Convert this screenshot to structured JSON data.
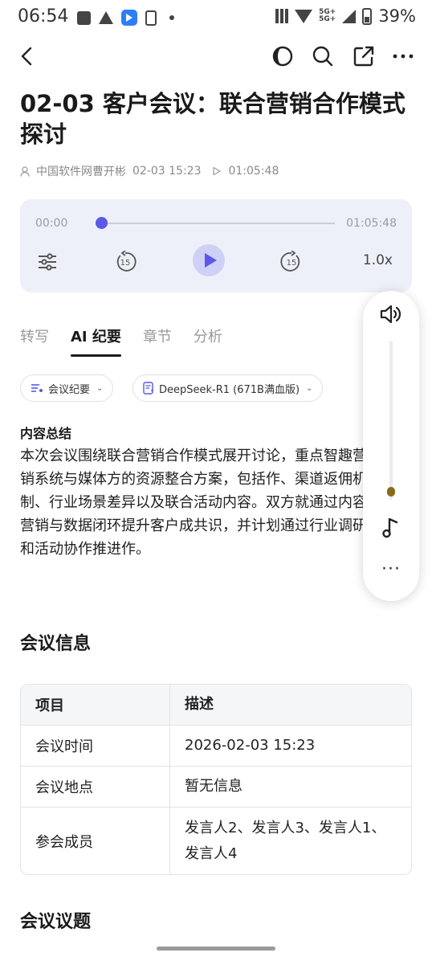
{
  "status_bar": {
    "time": "06:54",
    "network": "5G+\n5G+",
    "battery": "39%"
  },
  "nav": {
    "back_label": "back",
    "icons": [
      "theme-icon",
      "search-icon",
      "share-icon",
      "more-icon"
    ]
  },
  "page": {
    "title": "02-03 客户会议：联合营销合作模式探讨",
    "author": "中国软件网曹开彬",
    "datetime": "02-03 15:23",
    "duration": "01:05:48"
  },
  "player": {
    "current_time": "00:00",
    "total_time": "01:05:48",
    "progress": 0,
    "skip_back_seconds": "15",
    "skip_forward_seconds": "15",
    "speed": "1.0x"
  },
  "tabs": [
    {
      "label": "转写",
      "active": false
    },
    {
      "label": "AI 纪要",
      "active": true
    },
    {
      "label": "章节",
      "active": false
    },
    {
      "label": "分析",
      "active": false
    }
  ],
  "chips": {
    "template": "会议纪要",
    "model": "DeepSeek-R1 (671B满血版)"
  },
  "summary": {
    "heading": "内容总结",
    "text": "本次会议围绕联合营销合作模式展开讨论，重点智趣营销系统与媒体方的资源整合方案，包括作、渠道返佣机制、行业场景差异以及联合活动内容。双方就通过内容营销与数据闭环提升客户成共识，并计划通过行业调研和活动协作推进作。"
  },
  "meeting_info": {
    "heading": "会议信息",
    "columns": [
      "项目",
      "描述"
    ],
    "rows": [
      {
        "item": "会议时间",
        "desc": "2026-02-03 15:23"
      },
      {
        "item": "会议地点",
        "desc": "暂无信息"
      },
      {
        "item": "参会成员",
        "desc": "发言人2、发言人3、发言人1、发言人4"
      }
    ]
  },
  "topics": {
    "heading": "会议议题"
  },
  "volume_panel": {
    "level": 0.05,
    "more": "···"
  }
}
